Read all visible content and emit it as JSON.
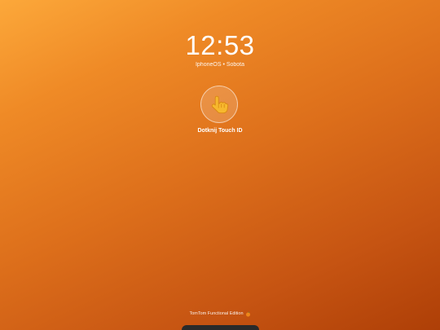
{
  "lock_screen": {
    "time": "12:53",
    "subtitle": "IphoneOS • Sobota",
    "touch_id": {
      "icon": "pointing-hand-icon",
      "label": "Dotknij Touch ID"
    },
    "edition": {
      "text": "TomTom Functional Edition",
      "icon": "orange-fruit-icon"
    }
  },
  "colors": {
    "background_top": "#fca83a",
    "background_bottom": "#ae3f07",
    "text": "#ffffff",
    "home_indicator": "#2a2a2a"
  }
}
